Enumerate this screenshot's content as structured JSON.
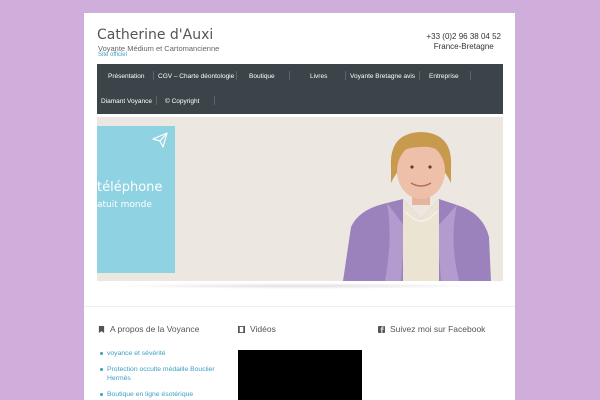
{
  "header": {
    "site_title": "Catherine d'Auxi",
    "subtitle": "Voyante Médium et Cartomancienne",
    "official": "Site officiel",
    "phone": "+33 (0)2 96 38 04 52",
    "region": "France-Bretagne"
  },
  "nav": {
    "items": [
      "Présentation",
      "CGV – Charte déontologie",
      "Boutique",
      "Livres",
      "Voyante Bretagne avis",
      "Entreprise",
      "Diamant Voyance",
      "© Copyright"
    ]
  },
  "banner": {
    "line1": "téléphone",
    "line2": "atuit monde"
  },
  "widgets": {
    "about_title": "A propos de la Voyance",
    "videos_title": "Vidéos",
    "facebook_title": "Suivez moi sur Facebook",
    "links": [
      "voyance et sévérité",
      "Protection occulte médaille Bouclier Hermès",
      "Boutique en ligne ésotérique"
    ]
  },
  "colors": {
    "page_background": "#cfaedb",
    "nav_background": "#3b4449",
    "accent_link": "#3aa0c0",
    "banner_card": "#8fd2e2"
  }
}
